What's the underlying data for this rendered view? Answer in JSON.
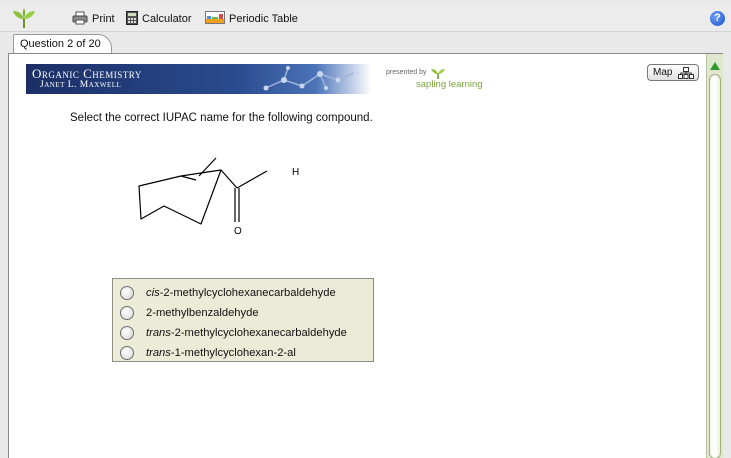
{
  "toolbar": {
    "print_label": "Print",
    "calculator_label": "Calculator",
    "periodic_table_label": "Periodic Table",
    "help_icon": "?"
  },
  "tab": {
    "label": "Question 2 of 20"
  },
  "banner": {
    "title": "Organic Chemistry",
    "author": "Janet L. Maxwell",
    "presented_by": "presented by",
    "brand": "sapling learning"
  },
  "map_button": {
    "label": "Map"
  },
  "question": {
    "prompt": "Select the correct IUPAC name for the following compound."
  },
  "structure": {
    "atom_h": "H",
    "atom_o": "O"
  },
  "choices": [
    {
      "prefix": "cis",
      "name": "-2-methylcyclohexanecarbaldehyde"
    },
    {
      "prefix": "",
      "name": "2-methylbenzaldehyde"
    },
    {
      "prefix": "trans",
      "name": "-2-methylcyclohexanecarbaldehyde"
    },
    {
      "prefix": "trans",
      "name": "-1-methylcyclohexan-2-al"
    }
  ],
  "colors": {
    "banner_dark": "#1b2f66",
    "brand_green": "#7aa63b",
    "choices_bg": "#ecebd8",
    "help_blue": "#1b4fc4"
  }
}
